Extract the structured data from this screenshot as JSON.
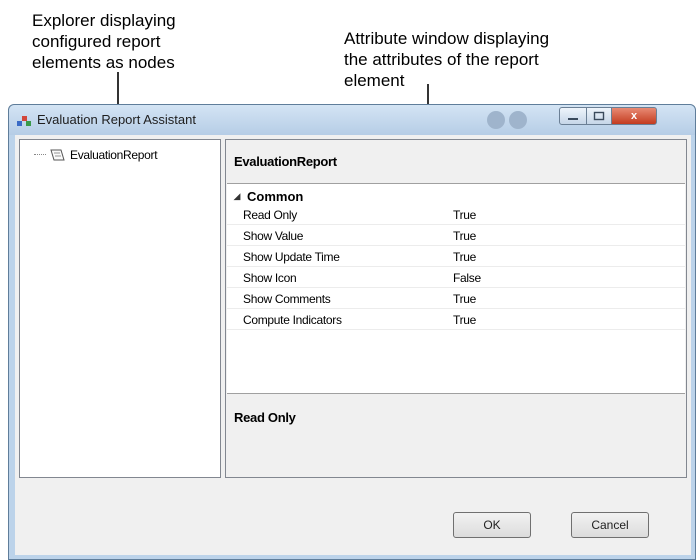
{
  "annotations": {
    "explorer": "Explorer displaying\nconfigured report\nelements as nodes",
    "attribute": "Attribute window displaying\nthe attributes of the report\nelement"
  },
  "window": {
    "title": "Evaluation Report Assistant",
    "close_glyph": "x"
  },
  "tree": {
    "nodes": [
      {
        "label": "EvaluationReport",
        "icon": "report-node-icon"
      }
    ]
  },
  "properties": {
    "header": "EvaluationReport",
    "category": {
      "label": "Common",
      "toggle": "◢"
    },
    "rows": [
      {
        "name": "Read Only",
        "value": "True"
      },
      {
        "name": "Show Value",
        "value": "True"
      },
      {
        "name": "Show Update Time",
        "value": "True"
      },
      {
        "name": "Show Icon",
        "value": "False"
      },
      {
        "name": "Show Comments",
        "value": "True"
      },
      {
        "name": "Compute Indicators",
        "value": "True"
      }
    ],
    "description_title": "Read Only"
  },
  "buttons": {
    "ok": "OK",
    "cancel": "Cancel"
  },
  "colors": {
    "title_gradient_top": "#d4e4f4",
    "close": "#c33c20",
    "window_frame": "#bcd3ea"
  }
}
